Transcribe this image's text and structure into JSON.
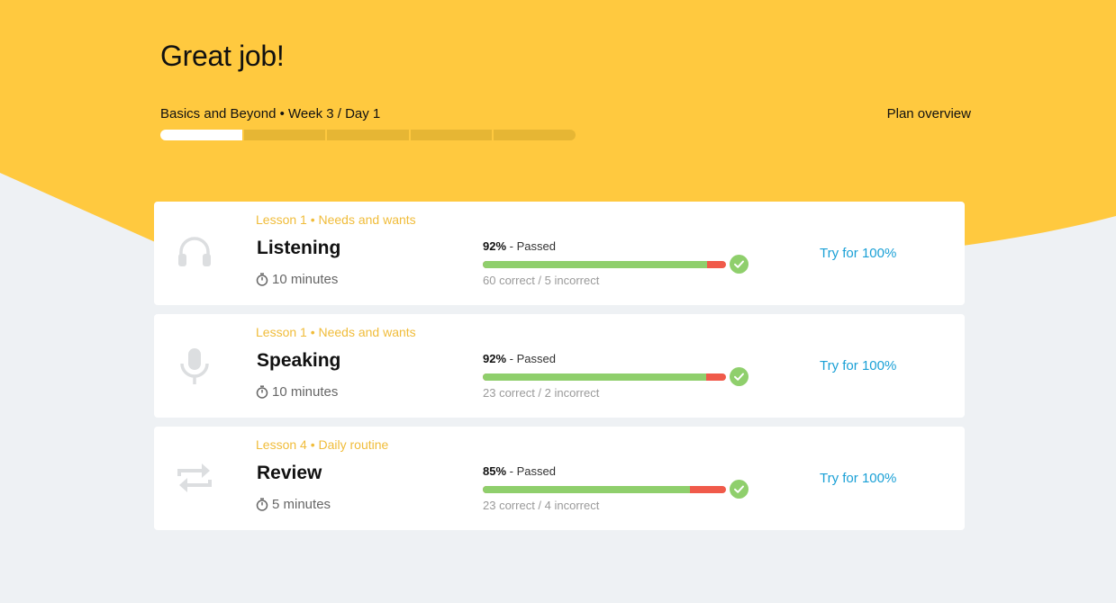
{
  "header": {
    "title": "Great job!",
    "plan_label": "Basics and Beyond • Week 3 / Day 1",
    "plan_overview_label": "Plan overview",
    "week_progress": {
      "segments_total": 5,
      "segments_completed": 1
    }
  },
  "colors": {
    "hero_yellow": "#ffc93f",
    "page_background": "#eef1f4",
    "lesson_tag": "#f0bc3a",
    "correct_green": "#8fcf6c",
    "incorrect_red": "#f05a4a",
    "link_blue": "#1aa0d6"
  },
  "lessons": [
    {
      "icon": "headphones-icon",
      "tag": "Lesson 1 • Needs and wants",
      "title": "Listening",
      "duration": "10 minutes",
      "score_pct": "92%",
      "status": "- Passed",
      "correct_fraction": 0.923,
      "counts": "60 correct / 5 incorrect",
      "action": "Try for 100%"
    },
    {
      "icon": "microphone-icon",
      "tag": "Lesson 1 • Needs and wants",
      "title": "Speaking",
      "duration": "10 minutes",
      "score_pct": "92%",
      "status": "- Passed",
      "correct_fraction": 0.92,
      "counts": "23 correct / 2 incorrect",
      "action": "Try for 100%"
    },
    {
      "icon": "repeat-icon",
      "tag": "Lesson 4 • Daily routine",
      "title": "Review",
      "duration": "5 minutes",
      "score_pct": "85%",
      "status": "- Passed",
      "correct_fraction": 0.852,
      "counts": "23 correct / 4 incorrect",
      "action": "Try for 100%"
    }
  ]
}
